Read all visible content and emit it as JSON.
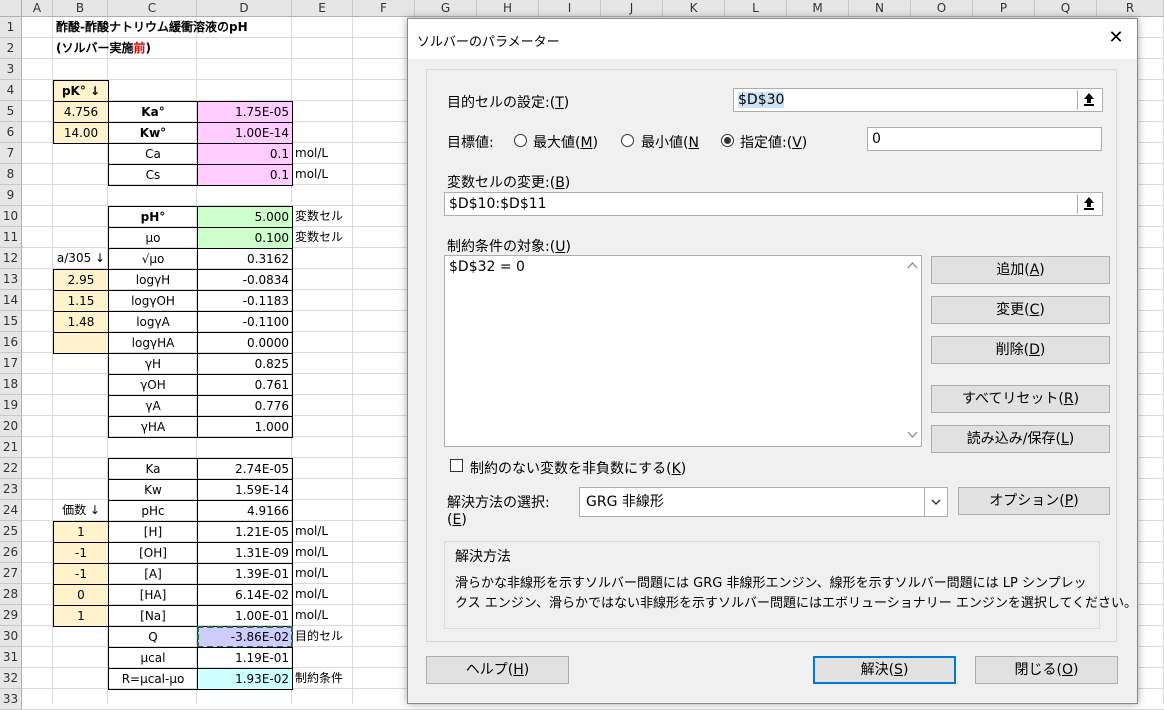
{
  "columns": [
    "A",
    "B",
    "C",
    "D",
    "E",
    "F",
    "G",
    "H",
    "I",
    "J",
    "K",
    "L",
    "M",
    "N",
    "O",
    "P",
    "Q",
    "R"
  ],
  "rows": [
    "1",
    "2",
    "3",
    "4",
    "5",
    "6",
    "7",
    "8",
    "9",
    "10",
    "11",
    "12",
    "13",
    "14",
    "15",
    "16",
    "17",
    "18",
    "19",
    "20",
    "21",
    "22",
    "23",
    "24",
    "25",
    "26",
    "27",
    "28",
    "29",
    "30",
    "31",
    "32",
    "33"
  ],
  "sheet": {
    "title": "酢酸-酢酸ナトリウム緩衝溶液のpH",
    "subtitle_prefix": "(ソルバー実施",
    "subtitle_red": "前",
    "subtitle_suffix": ")",
    "pk_header": "pK° ↓",
    "a305_header": "a/305 ↓",
    "valence_header": "価数 ↓",
    "b_values": {
      "r5": "4.756",
      "r6": "14.00",
      "r13": "2.95",
      "r14": "1.15",
      "r15": "1.48",
      "r25": "1",
      "r26": "-1",
      "r27": "-1",
      "r28": "0",
      "r29": "1"
    },
    "c_labels": {
      "r5": "Ka°",
      "r6": "Kw°",
      "r7": "Ca",
      "r8": "Cs",
      "r10": "pH°",
      "r11": "μo",
      "r12": "√μo",
      "r13": "logγH",
      "r14": "logγOH",
      "r15": "logγA",
      "r16": "logγHA",
      "r17": "γH",
      "r18": "γOH",
      "r19": "γA",
      "r20": "γHA",
      "r22": "Ka",
      "r23": "Kw",
      "r24": "pHc",
      "r25": "[H]",
      "r26": "[OH]",
      "r27": "[A]",
      "r28": "[HA]",
      "r29": "[Na]",
      "r30": "Q",
      "r31": "μcal",
      "r32": "R=μcal-μo"
    },
    "d_values": {
      "r5": "1.75E-05",
      "r6": "1.00E-14",
      "r7": "0.1",
      "r8": "0.1",
      "r10": "5.000",
      "r11": "0.100",
      "r12": "0.3162",
      "r13": "-0.0834",
      "r14": "-0.1183",
      "r15": "-0.1100",
      "r16": "0.0000",
      "r17": "0.825",
      "r18": "0.761",
      "r19": "0.776",
      "r20": "1.000",
      "r22": "2.74E-05",
      "r23": "1.59E-14",
      "r24": "4.9166",
      "r25": "1.21E-05",
      "r26": "1.31E-09",
      "r27": "1.39E-01",
      "r28": "6.14E-02",
      "r29": "1.00E-01",
      "r30": "-3.86E-02",
      "r31": "1.19E-01",
      "r32": "1.93E-02"
    },
    "e_labels": {
      "r7": "mol/L",
      "r8": "mol/L",
      "r10": "変数セル",
      "r11": "変数セル",
      "r25": "mol/L",
      "r26": "mol/L",
      "r27": "mol/L",
      "r28": "mol/L",
      "r29": "mol/L",
      "r30": "目的セル",
      "r32": "制約条件"
    }
  },
  "dialog": {
    "title": "ソルバーのパラメーター",
    "close_glyph": "✕",
    "objective_label": "目的セルの設定:(",
    "objective_key": "T",
    "objective_value": "$D$30",
    "target_label": "目標値:",
    "opt_max": "最大値(",
    "opt_max_key": "M",
    "opt_min": "最小値(",
    "opt_min_key": "N",
    "opt_value": "指定値:(",
    "opt_value_key": "V",
    "target_value": "0",
    "variable_label": "変数セルの変更:(",
    "variable_key": "B",
    "variable_value": "$D$10:$D$11",
    "constraints_label": "制約条件の対象:(",
    "constraints_key": "U",
    "constraints": [
      "$D$32 = 0"
    ],
    "btn_add": "追加(",
    "btn_add_key": "A",
    "btn_change": "変更(",
    "btn_change_key": "C",
    "btn_delete": "削除(",
    "btn_delete_key": "D",
    "btn_reset": "すべてリセット(",
    "btn_reset_key": "R",
    "btn_load": "読み込み/保存(",
    "btn_load_key": "L",
    "nonneg_label": "制約のない変数を非負数にする(",
    "nonneg_key": "K",
    "method_label_1": "解決方法の選択:",
    "method_label_2": "(",
    "method_key": "E",
    "method_value": "GRG 非線形",
    "btn_options": "オプション(",
    "btn_options_key": "P",
    "method_group_title": "解決方法",
    "method_desc_1": "滑らかな非線形を示すソルバー問題には GRG 非線形エンジン、線形を示すソルバー問題には LP シンプレッ",
    "method_desc_2": "クス エンジン、滑らかではない非線形を示すソルバー問題にはエボリューショナリー エンジンを選択してください。",
    "btn_help": "ヘルプ(",
    "btn_help_key": "H",
    "btn_solve": "解決(",
    "btn_solve_key": "S",
    "btn_close": "閉じる(",
    "btn_close_key": "O",
    "paren_close": ")"
  },
  "colors": {
    "yellow": "#fff2cc",
    "pink": "#ffccff",
    "green": "#ccffcc",
    "lavender": "#ccccff",
    "cyan": "#ccffff",
    "accent": "#0078d7"
  }
}
